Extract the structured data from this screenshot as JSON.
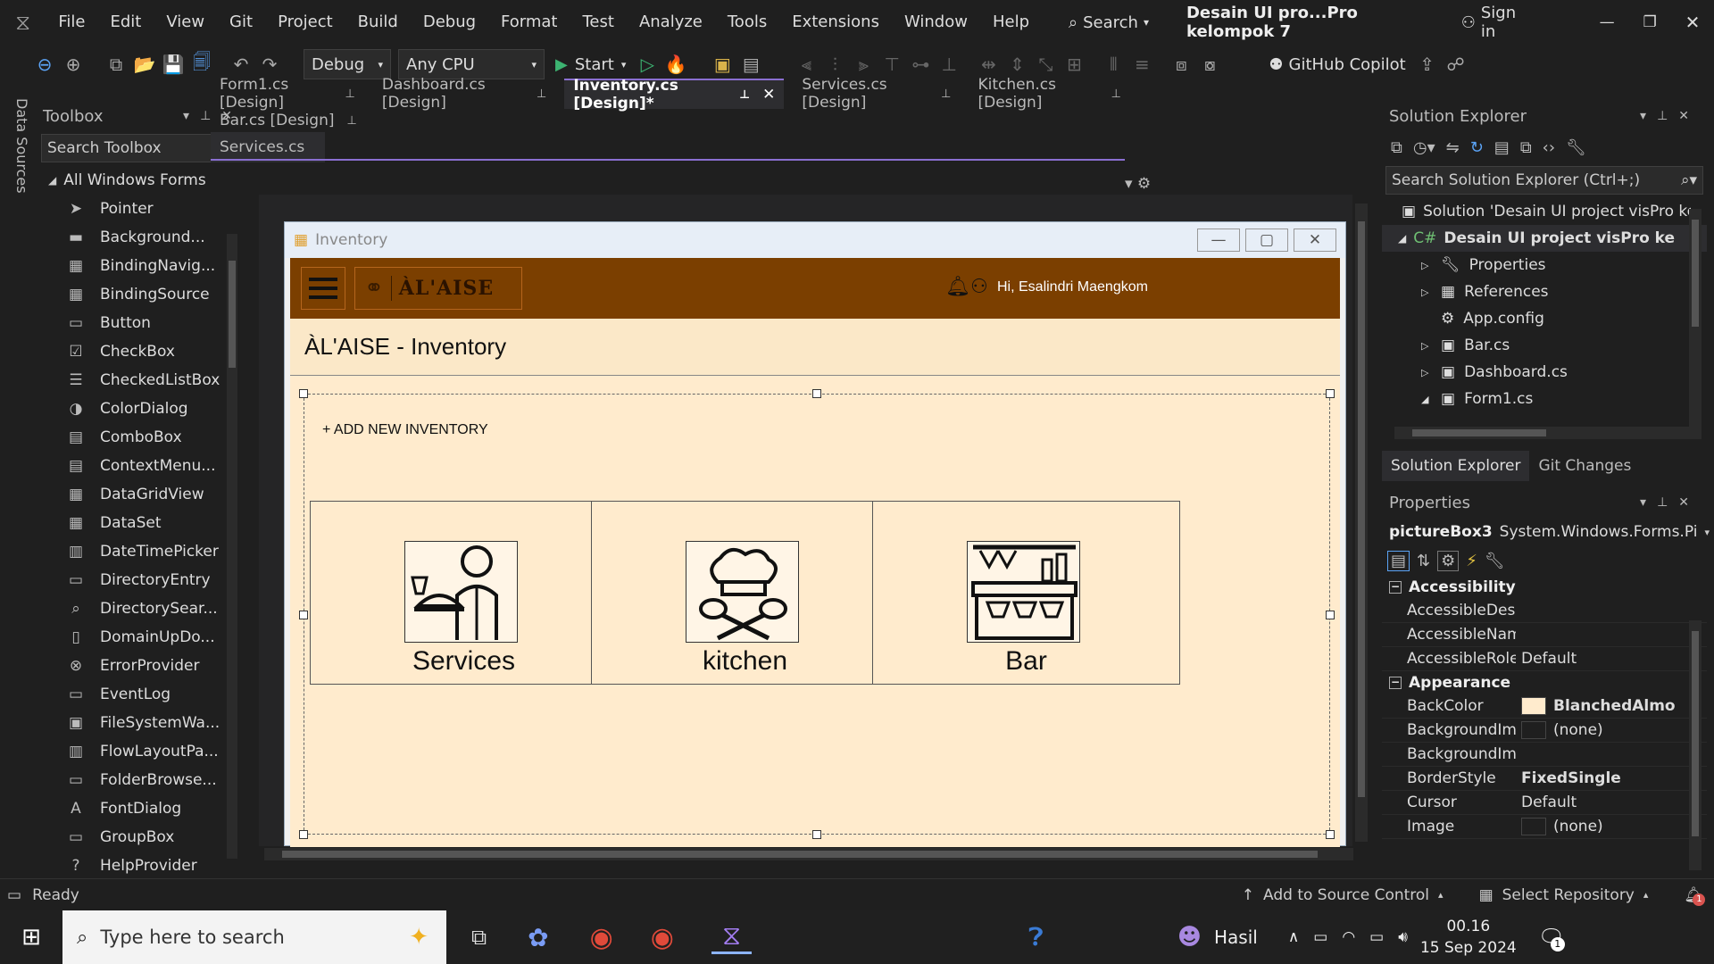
{
  "titlebar": {
    "menu": [
      "File",
      "Edit",
      "View",
      "Git",
      "Project",
      "Build",
      "Debug",
      "Format",
      "Test",
      "Analyze",
      "Tools",
      "Extensions",
      "Window",
      "Help"
    ],
    "search_label": "Search",
    "solution_title": "Desain UI pro...Pro kelompok 7",
    "signin": "Sign in"
  },
  "toolbar": {
    "config": "Debug",
    "platform": "Any CPU",
    "start": "Start",
    "copilot": "GitHub Copilot"
  },
  "toolbox": {
    "side_label": "Data Sources",
    "title": "Toolbox",
    "search_placeholder": "Search Toolbox",
    "group": "All Windows Forms",
    "items": [
      "Pointer",
      "Background...",
      "BindingNavig...",
      "BindingSource",
      "Button",
      "CheckBox",
      "CheckedListBox",
      "ColorDialog",
      "ComboBox",
      "ContextMenu...",
      "DataGridView",
      "DataSet",
      "DateTimePicker",
      "DirectoryEntry",
      "DirectorySear...",
      "DomainUpDo...",
      "ErrorProvider",
      "EventLog",
      "FileSystemWa...",
      "FlowLayoutPa...",
      "FolderBrowse...",
      "FontDialog",
      "GroupBox",
      "HelpProvider"
    ]
  },
  "tabs": {
    "row1": [
      "Form1.cs [Design]",
      "Dashboard.cs [Design]",
      "Inventory.cs [Design]*",
      "Services.cs [Design]",
      "Kitchen.cs [Design]"
    ],
    "row2": [
      "Bar.cs [Design]"
    ],
    "row3": [
      "Services.cs"
    ]
  },
  "form": {
    "window_title": "Inventory",
    "brand": "ÀL'AISE",
    "greeting": "Hi, Esalindri Maengkom",
    "page_title": "ÀL'AISE - Inventory",
    "add_link": "+ ADD NEW INVENTORY",
    "cards": [
      "Services",
      "kitchen",
      "Bar"
    ]
  },
  "solution_explorer": {
    "title": "Solution Explorer",
    "search_placeholder": "Search Solution Explorer (Ctrl+;)",
    "solution": "Solution 'Desain UI project visPro ke",
    "project": "Desain UI project visPro kelon",
    "items": [
      "Properties",
      "References",
      "App.config",
      "Bar.cs",
      "Dashboard.cs",
      "Form1.cs"
    ],
    "bottom_tabs": [
      "Solution Explorer",
      "Git Changes"
    ]
  },
  "properties": {
    "title": "Properties",
    "object": "pictureBox3",
    "type": "System.Windows.Forms.Pi",
    "cat1": "Accessibility",
    "cat1_rows": [
      [
        "AccessibleDescript",
        ""
      ],
      [
        "AccessibleName",
        ""
      ],
      [
        "AccessibleRole",
        "Default"
      ]
    ],
    "cat2": "Appearance",
    "cat2_rows": [
      [
        "BackColor",
        "BlanchedAlmo"
      ],
      [
        "BackgroundImage",
        "(none)"
      ],
      [
        "BackgroundImage Tile",
        ""
      ],
      [
        "BorderStyle",
        "FixedSingle"
      ],
      [
        "Cursor",
        "Default"
      ],
      [
        "Image",
        "(none)"
      ]
    ],
    "backcolor_hex": "#ffebcd"
  },
  "status": {
    "ready": "Ready",
    "source_control": "Add to Source Control",
    "repository": "Select Repository",
    "notif_count": "1"
  },
  "taskbar": {
    "search_placeholder": "Type here to search",
    "user": "Hasil",
    "time": "00.16",
    "date": "15 Sep 2024",
    "notif": "1"
  }
}
